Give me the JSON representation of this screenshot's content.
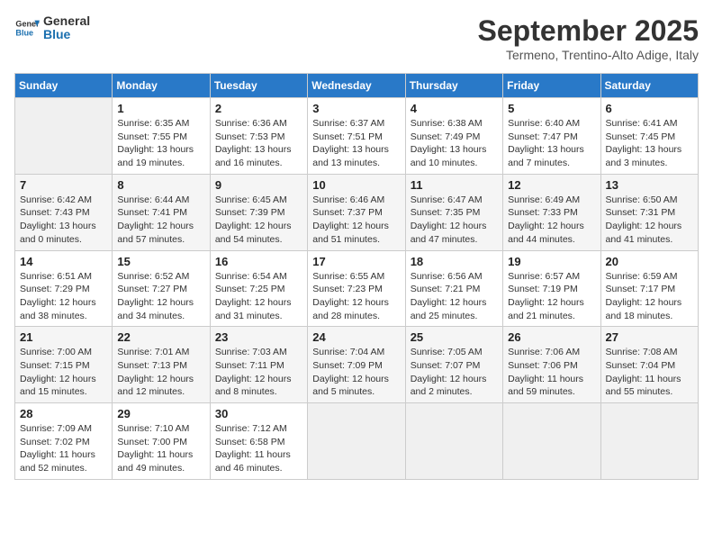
{
  "header": {
    "logo_line1": "General",
    "logo_line2": "Blue",
    "month_title": "September 2025",
    "subtitle": "Termeno, Trentino-Alto Adige, Italy"
  },
  "days_of_week": [
    "Sunday",
    "Monday",
    "Tuesday",
    "Wednesday",
    "Thursday",
    "Friday",
    "Saturday"
  ],
  "weeks": [
    [
      {
        "day": "",
        "info": ""
      },
      {
        "day": "1",
        "info": "Sunrise: 6:35 AM\nSunset: 7:55 PM\nDaylight: 13 hours\nand 19 minutes."
      },
      {
        "day": "2",
        "info": "Sunrise: 6:36 AM\nSunset: 7:53 PM\nDaylight: 13 hours\nand 16 minutes."
      },
      {
        "day": "3",
        "info": "Sunrise: 6:37 AM\nSunset: 7:51 PM\nDaylight: 13 hours\nand 13 minutes."
      },
      {
        "day": "4",
        "info": "Sunrise: 6:38 AM\nSunset: 7:49 PM\nDaylight: 13 hours\nand 10 minutes."
      },
      {
        "day": "5",
        "info": "Sunrise: 6:40 AM\nSunset: 7:47 PM\nDaylight: 13 hours\nand 7 minutes."
      },
      {
        "day": "6",
        "info": "Sunrise: 6:41 AM\nSunset: 7:45 PM\nDaylight: 13 hours\nand 3 minutes."
      }
    ],
    [
      {
        "day": "7",
        "info": "Sunrise: 6:42 AM\nSunset: 7:43 PM\nDaylight: 13 hours\nand 0 minutes."
      },
      {
        "day": "8",
        "info": "Sunrise: 6:44 AM\nSunset: 7:41 PM\nDaylight: 12 hours\nand 57 minutes."
      },
      {
        "day": "9",
        "info": "Sunrise: 6:45 AM\nSunset: 7:39 PM\nDaylight: 12 hours\nand 54 minutes."
      },
      {
        "day": "10",
        "info": "Sunrise: 6:46 AM\nSunset: 7:37 PM\nDaylight: 12 hours\nand 51 minutes."
      },
      {
        "day": "11",
        "info": "Sunrise: 6:47 AM\nSunset: 7:35 PM\nDaylight: 12 hours\nand 47 minutes."
      },
      {
        "day": "12",
        "info": "Sunrise: 6:49 AM\nSunset: 7:33 PM\nDaylight: 12 hours\nand 44 minutes."
      },
      {
        "day": "13",
        "info": "Sunrise: 6:50 AM\nSunset: 7:31 PM\nDaylight: 12 hours\nand 41 minutes."
      }
    ],
    [
      {
        "day": "14",
        "info": "Sunrise: 6:51 AM\nSunset: 7:29 PM\nDaylight: 12 hours\nand 38 minutes."
      },
      {
        "day": "15",
        "info": "Sunrise: 6:52 AM\nSunset: 7:27 PM\nDaylight: 12 hours\nand 34 minutes."
      },
      {
        "day": "16",
        "info": "Sunrise: 6:54 AM\nSunset: 7:25 PM\nDaylight: 12 hours\nand 31 minutes."
      },
      {
        "day": "17",
        "info": "Sunrise: 6:55 AM\nSunset: 7:23 PM\nDaylight: 12 hours\nand 28 minutes."
      },
      {
        "day": "18",
        "info": "Sunrise: 6:56 AM\nSunset: 7:21 PM\nDaylight: 12 hours\nand 25 minutes."
      },
      {
        "day": "19",
        "info": "Sunrise: 6:57 AM\nSunset: 7:19 PM\nDaylight: 12 hours\nand 21 minutes."
      },
      {
        "day": "20",
        "info": "Sunrise: 6:59 AM\nSunset: 7:17 PM\nDaylight: 12 hours\nand 18 minutes."
      }
    ],
    [
      {
        "day": "21",
        "info": "Sunrise: 7:00 AM\nSunset: 7:15 PM\nDaylight: 12 hours\nand 15 minutes."
      },
      {
        "day": "22",
        "info": "Sunrise: 7:01 AM\nSunset: 7:13 PM\nDaylight: 12 hours\nand 12 minutes."
      },
      {
        "day": "23",
        "info": "Sunrise: 7:03 AM\nSunset: 7:11 PM\nDaylight: 12 hours\nand 8 minutes."
      },
      {
        "day": "24",
        "info": "Sunrise: 7:04 AM\nSunset: 7:09 PM\nDaylight: 12 hours\nand 5 minutes."
      },
      {
        "day": "25",
        "info": "Sunrise: 7:05 AM\nSunset: 7:07 PM\nDaylight: 12 hours\nand 2 minutes."
      },
      {
        "day": "26",
        "info": "Sunrise: 7:06 AM\nSunset: 7:06 PM\nDaylight: 11 hours\nand 59 minutes."
      },
      {
        "day": "27",
        "info": "Sunrise: 7:08 AM\nSunset: 7:04 PM\nDaylight: 11 hours\nand 55 minutes."
      }
    ],
    [
      {
        "day": "28",
        "info": "Sunrise: 7:09 AM\nSunset: 7:02 PM\nDaylight: 11 hours\nand 52 minutes."
      },
      {
        "day": "29",
        "info": "Sunrise: 7:10 AM\nSunset: 7:00 PM\nDaylight: 11 hours\nand 49 minutes."
      },
      {
        "day": "30",
        "info": "Sunrise: 7:12 AM\nSunset: 6:58 PM\nDaylight: 11 hours\nand 46 minutes."
      },
      {
        "day": "",
        "info": ""
      },
      {
        "day": "",
        "info": ""
      },
      {
        "day": "",
        "info": ""
      },
      {
        "day": "",
        "info": ""
      }
    ]
  ]
}
